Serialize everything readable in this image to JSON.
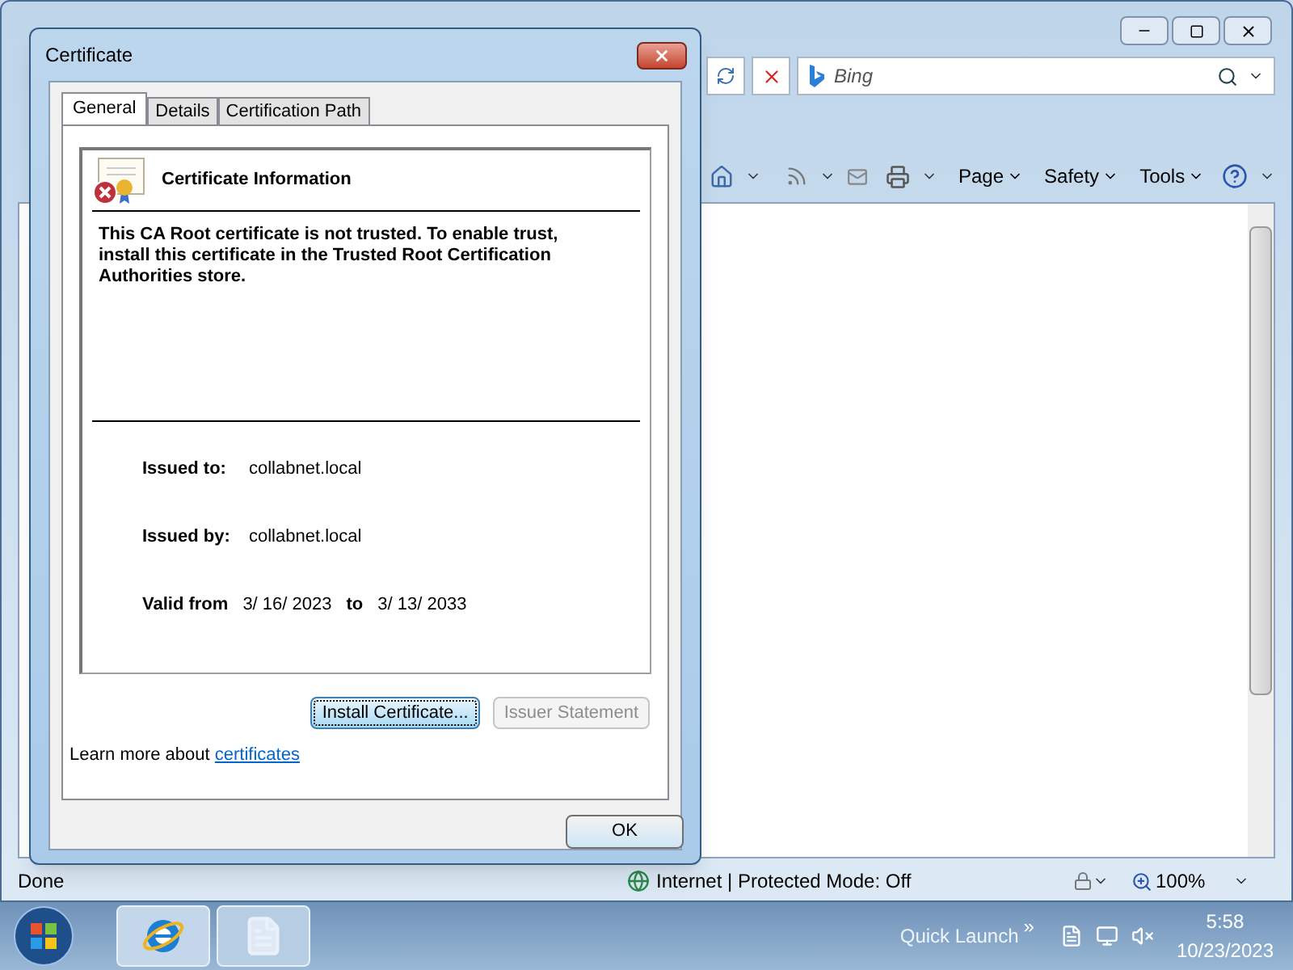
{
  "browser": {
    "search_placeholder": "Bing",
    "commands": [
      {
        "label": "Page"
      },
      {
        "label": "Safety"
      },
      {
        "label": "Tools"
      }
    ],
    "status": "Done",
    "zone": "Internet | Protected Mode: Off",
    "zoom": "100%"
  },
  "dialog": {
    "title": "Certificate",
    "tabs": [
      {
        "label": "General",
        "selected": true
      },
      {
        "label": "Details",
        "selected": false
      },
      {
        "label": "Certification Path",
        "selected": false
      }
    ],
    "heading": "Certificate Information",
    "message": "This CA Root certificate is not trusted. To enable trust, install this certificate in the Trusted Root Certification Authorities store.",
    "fields": [
      {
        "label": "Issued to:",
        "value": "collabnet.local"
      },
      {
        "label": "Issued by:",
        "value": "collabnet.local"
      }
    ],
    "validity": {
      "label": "Valid from",
      "from": "3/ 16/ 2023",
      "to_label": "to",
      "to": "3/ 13/ 2033"
    },
    "buttons": [
      {
        "label": "Install Certificate...",
        "disabled": false,
        "focused": true
      },
      {
        "label": "Issuer Statement",
        "disabled": true,
        "focused": false
      }
    ],
    "learn_more": "Learn more about",
    "link": "certificates",
    "ok": "OK"
  },
  "taskbar": {
    "quick_launch": "Quick Launch",
    "chevron": "»",
    "time": "5:58",
    "date": "10/23/2023"
  }
}
